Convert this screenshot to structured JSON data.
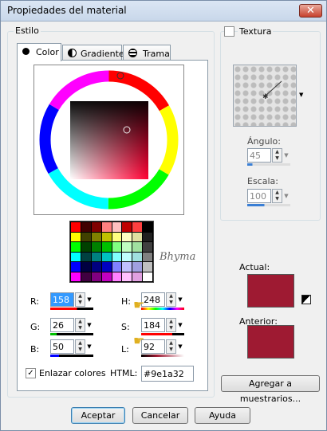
{
  "window": {
    "title": "Propiedades del material",
    "close_glyph": "✕"
  },
  "style_group": {
    "label": "Estilo"
  },
  "tabs": [
    {
      "label": "Color",
      "icon": "dot-icon",
      "active": true
    },
    {
      "label": "Gradiente",
      "icon": "half-circle-icon",
      "active": false
    },
    {
      "label": "Trama",
      "icon": "pattern-icon",
      "active": false
    }
  ],
  "watermark": "Bhyma",
  "rgb": {
    "r_label": "R:",
    "r_value": "158",
    "g_label": "G:",
    "g_value": "26",
    "b_label": "B:",
    "b_value": "50"
  },
  "hsl": {
    "h_label": "H:",
    "h_value": "248",
    "s_label": "S:",
    "s_value": "184",
    "l_label": "L:",
    "l_value": "92"
  },
  "link_colors": {
    "label": "Enlazar colores",
    "checked": true,
    "check_glyph": "✓"
  },
  "html_field": {
    "label": "HTML:",
    "value": "#9e1a32"
  },
  "texture": {
    "label": "Textura",
    "checked": false,
    "angle_label": "Ángulo:",
    "angle_value": "45",
    "scale_label": "Escala:",
    "scale_value": "100"
  },
  "current": {
    "label": "Actual:",
    "color": "#9e1a32"
  },
  "previous": {
    "label": "Anterior:",
    "color": "#9e1a32"
  },
  "add_to_swatches": "Agregar a muestrarios...",
  "buttons": {
    "accept": "Aceptar",
    "cancel": "Cancelar",
    "help": "Ayuda"
  },
  "palette": [
    [
      "#ff0000",
      "#400000",
      "#800000",
      "#ff8080",
      "#ffc0c0",
      "#c00000",
      "#ff4040",
      "#000000"
    ],
    [
      "#ffff00",
      "#404000",
      "#808000",
      "#c0c000",
      "#ffff80",
      "#ffffc0",
      "#e0e0a0",
      "#202020"
    ],
    [
      "#00ff00",
      "#004000",
      "#008000",
      "#00c000",
      "#80ff80",
      "#c0ffc0",
      "#a0e0a0",
      "#404040"
    ],
    [
      "#00ffff",
      "#004040",
      "#008080",
      "#00c0c0",
      "#80ffff",
      "#c0ffff",
      "#a0e0e0",
      "#808080"
    ],
    [
      "#0000ff",
      "#000040",
      "#000080",
      "#0000c0",
      "#8080ff",
      "#c0c0ff",
      "#a0a0e0",
      "#c0c0c0"
    ],
    [
      "#ff00ff",
      "#400040",
      "#800080",
      "#c000c0",
      "#ff80ff",
      "#ffc0ff",
      "#e0a0e0",
      "#ffffff"
    ]
  ]
}
